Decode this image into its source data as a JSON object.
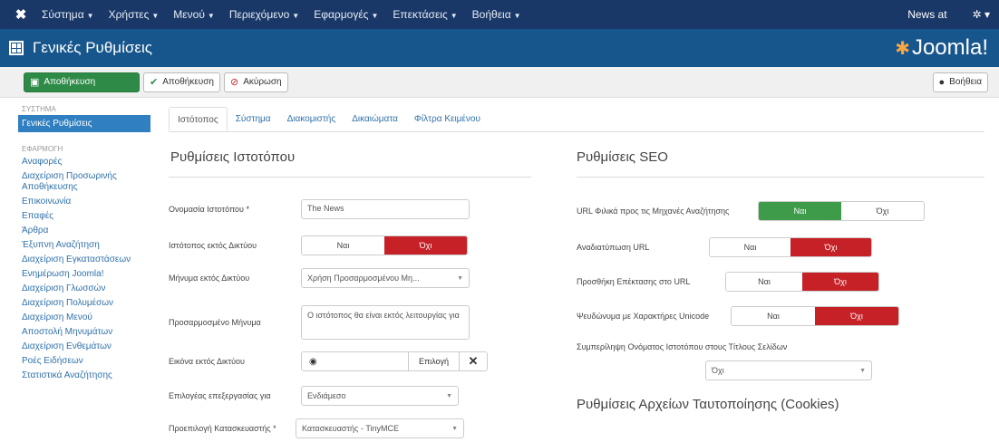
{
  "topbar": {
    "logo": "✖",
    "menu": [
      "Σύστημα",
      "Χρήστες",
      "Μενού",
      "Περιεχόμενο",
      "Εφαρμογές",
      "Επεκτάσεις",
      "Βοήθεια"
    ],
    "news_label": "News at",
    "gear": "✲"
  },
  "header": {
    "title": "Γενικές Ρυθμίσεις",
    "brand": "Joomla!"
  },
  "toolbar": {
    "save": "Αποθήκευση",
    "save_close": "Αποθήκευση",
    "cancel": "Ακύρωση",
    "help": "Βοήθεια"
  },
  "sidebar": {
    "system_header": "ΣΥΣΤΗΜΑ",
    "active": "Γενικές Ρυθμίσεις",
    "components_header": "ΕΦΑΡΜΟΓΗ",
    "items": [
      "Αναφορές",
      "Διαχείριση Προσωρινής Αποθήκευσης",
      "Επικοινωνία",
      "Επαφές",
      "Άρθρα",
      "Έξυπνη Αναζήτηση",
      "Διαχείριση Εγκαταστάσεων",
      "Ενημέρωση Joomla!",
      "Διαχείριση Γλωσσών",
      "Διαχείριση Πολυμέσων",
      "Διαχείριση Μενού",
      "Αποστολή Μηνυμάτων",
      "Διαχείριση Ενθεμάτων",
      "Ροές Ειδήσεων",
      "Στατιστικά Αναζήτησης"
    ]
  },
  "tabs": [
    "Ιστότοπος",
    "Σύστημα",
    "Διακομιστής",
    "Δικαιώματα",
    "Φίλτρα Κειμένου"
  ],
  "site": {
    "title": "Ρυθμίσεις Ιστοτόπου",
    "name_label": "Ονομασία Ιστοτόπου *",
    "name_value": "The News",
    "offline_label": "Ιστότοπος εκτός Δικτύου",
    "yes": "Ναι",
    "no": "Όχι",
    "offline_msg_label": "Μήνυμα εκτός Δικτύου",
    "offline_msg_value": "Χρήση Προσαρμοσμένου Μη...",
    "custom_msg_label": "Προσαρμοσμένο Μήνυμα",
    "custom_msg_value": "Ο ιστότοπος θα είναι εκτός λειτουργίας για",
    "offline_image_label": "Εικόνα εκτός Δικτύου",
    "select_btn": "Επιλογή",
    "editor_label": "Επιλογέας επεξεργασίας για",
    "editor_value": "Ενδιάμεσο",
    "captcha_label": "Προεπιλογή Κατασκευαστής *",
    "captcha_value": "Κατασκευαστής - TinyMCE"
  },
  "seo": {
    "title": "Ρυθμίσεις SEO",
    "friendly_label": "URL Φιλικά προς τις Μηχανές Αναζήτησης",
    "rewrite_label": "Αναδιατύπωση URL",
    "suffix_label": "Προσθήκη Επέκτασης στο URL",
    "unicode_label": "Ψευδώνυμα με Χαρακτήρες Unicode",
    "sitename_label": "Συμπερίληψη Ονόματος Ιστοτόπου στους Τίτλους Σελίδων",
    "sitename_value": "Όχι",
    "yes": "Ναι",
    "no": "Όχι"
  },
  "cookies": {
    "title": "Ρυθμίσεις Αρχείων Ταυτοποίησης (Cookies)"
  }
}
